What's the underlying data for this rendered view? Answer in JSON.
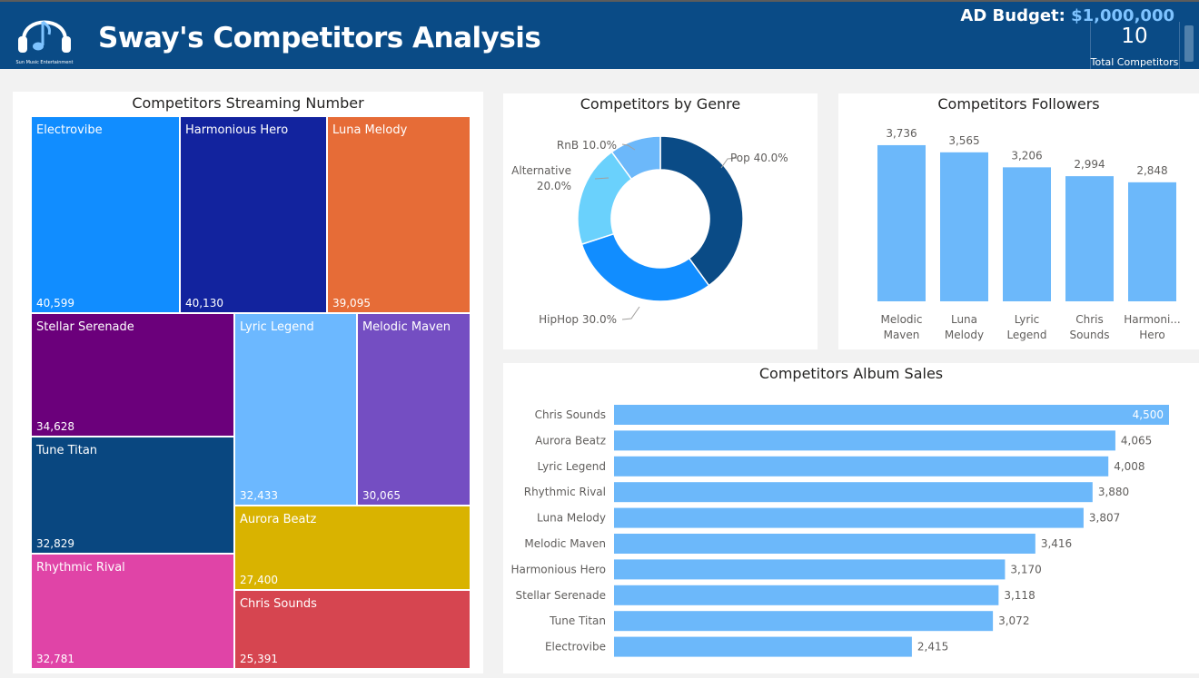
{
  "header": {
    "logo_text": "Sun Music Entertainment",
    "title": "Sway's Competitors Analysis",
    "budget_label": "AD Budget:",
    "budget_value": "$1,000,000",
    "total_competitors": "10",
    "total_competitors_label": "Total Competitors"
  },
  "colors": {
    "header_bg": "#0a4b86",
    "bar": "#6cb8fa",
    "budget_accent": "#7ec3ff"
  },
  "chart_data": [
    {
      "type": "treemap",
      "title": "Competitors Streaming Number",
      "items": [
        {
          "label": "Electrovibe",
          "value": 40599,
          "display": "40,599",
          "color": "#118dff"
        },
        {
          "label": "Harmonious Hero",
          "value": 40130,
          "display": "40,130",
          "color": "#12239e"
        },
        {
          "label": "Luna Melody",
          "value": 39095,
          "display": "39,095",
          "color": "#e66c37"
        },
        {
          "label": "Stellar Serenade",
          "value": 34628,
          "display": "34,628",
          "color": "#6b007b"
        },
        {
          "label": "Tune Titan",
          "value": 32829,
          "display": "32,829",
          "color": "#094780"
        },
        {
          "label": "Rhythmic Rival",
          "value": 32781,
          "display": "32,781",
          "color": "#e044a7"
        },
        {
          "label": "Lyric Legend",
          "value": 32433,
          "display": "32,433",
          "color": "#6cb8ff"
        },
        {
          "label": "Melodic Maven",
          "value": 30065,
          "display": "30,065",
          "color": "#744ec2"
        },
        {
          "label": "Aurora Beatz",
          "value": 27400,
          "display": "27,400",
          "color": "#d9b300"
        },
        {
          "label": "Chris Sounds",
          "value": 25391,
          "display": "25,391",
          "color": "#d64550"
        }
      ]
    },
    {
      "type": "pie",
      "title": "Competitors by Genre",
      "slices": [
        {
          "label": "Pop",
          "value": 40.0,
          "display": "Pop 40.0%",
          "color": "#0a4b86"
        },
        {
          "label": "HipHop",
          "value": 30.0,
          "display": "HipHop 30.0%",
          "color": "#118dff"
        },
        {
          "label": "Alternative",
          "value": 20.0,
          "display_lines": [
            "Alternative",
            "20.0%"
          ],
          "color": "#6ad1fc"
        },
        {
          "label": "RnB",
          "value": 10.0,
          "display": "RnB 10.0%",
          "color": "#6cb8fa"
        }
      ]
    },
    {
      "type": "bar",
      "title": "Competitors Followers",
      "categories": [
        [
          "Melodic",
          "Maven"
        ],
        [
          "Luna",
          "Melody"
        ],
        [
          "Lyric",
          "Legend"
        ],
        [
          "Chris",
          "Sounds"
        ],
        [
          "Harmoni...",
          "Hero"
        ]
      ],
      "values": [
        3736,
        3565,
        3206,
        2994,
        2848
      ],
      "value_labels": [
        "3,736",
        "3,565",
        "3,206",
        "2,994",
        "2,848"
      ],
      "ylim": [
        0,
        3800
      ]
    },
    {
      "type": "bar",
      "orientation": "horizontal",
      "title": "Competitors Album Sales",
      "categories": [
        "Chris Sounds",
        "Aurora Beatz",
        "Lyric Legend",
        "Rhythmic Rival",
        "Luna Melody",
        "Melodic Maven",
        "Harmonious Hero",
        "Stellar Serenade",
        "Tune Titan",
        "Electrovibe"
      ],
      "values": [
        4500,
        4065,
        4008,
        3880,
        3807,
        3416,
        3170,
        3118,
        3072,
        2415
      ],
      "value_labels": [
        "4,500",
        "4,065",
        "4,008",
        "3,880",
        "3,807",
        "3,416",
        "3,170",
        "3,118",
        "3,072",
        "2,415"
      ],
      "xlim": [
        0,
        4500
      ]
    }
  ]
}
